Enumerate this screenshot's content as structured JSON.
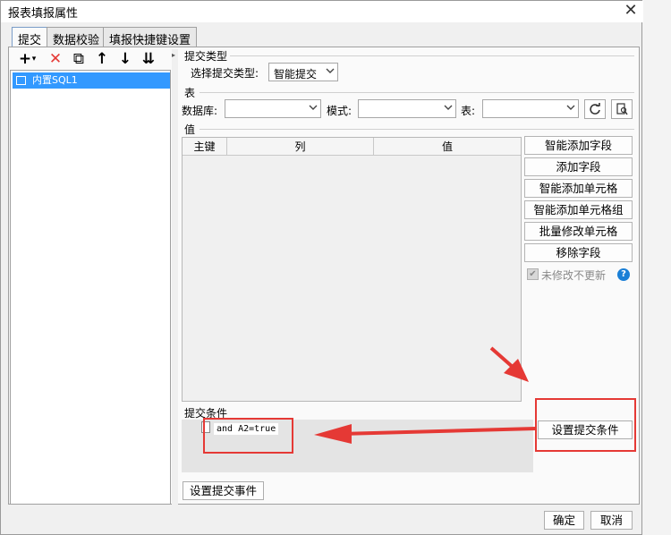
{
  "dialog": {
    "title": "报表填报属性",
    "close_glyph": "✕"
  },
  "tabs": [
    {
      "label": "提交",
      "active": true
    },
    {
      "label": "数据校验",
      "active": false
    },
    {
      "label": "填报快捷键设置",
      "active": false
    }
  ],
  "toolbar": {
    "add_glyph": "+",
    "add_dropdown_glyph": "▾",
    "delete_glyph": "✕",
    "copy_glyph": "⧉",
    "up_glyph": "↑",
    "down_glyph": "↓",
    "bottom_glyph": "⇊"
  },
  "tree": {
    "items": [
      {
        "label": "内置SQL1"
      }
    ]
  },
  "submit_type": {
    "section_title": "提交类型",
    "label": "选择提交类型:",
    "value": "智能提交"
  },
  "table_section": {
    "section_title": "表",
    "database_label": "数据库:",
    "database_value": "",
    "schema_label": "模式:",
    "schema_value": "",
    "table_label": "表:",
    "table_value": ""
  },
  "values_section": {
    "section_title": "值",
    "columns": [
      "主键",
      "列",
      "值"
    ],
    "rows": []
  },
  "side_buttons": [
    "智能添加字段",
    "添加字段",
    "智能添加单元格",
    "智能添加单元格组",
    "批量修改单元格",
    "移除字段"
  ],
  "no_update_unmodified": {
    "label": "未修改不更新",
    "checked": true
  },
  "help_glyph": "?",
  "submit_condition": {
    "section_title": "提交条件",
    "code": "and A2=true",
    "button_label": "设置提交条件"
  },
  "event_button": "设置提交事件",
  "footer": {
    "ok": "确定",
    "cancel": "取消"
  },
  "colors": {
    "annotation_red": "#e53935",
    "selection_blue": "#3399ff",
    "help_blue": "#1a7fd6"
  }
}
